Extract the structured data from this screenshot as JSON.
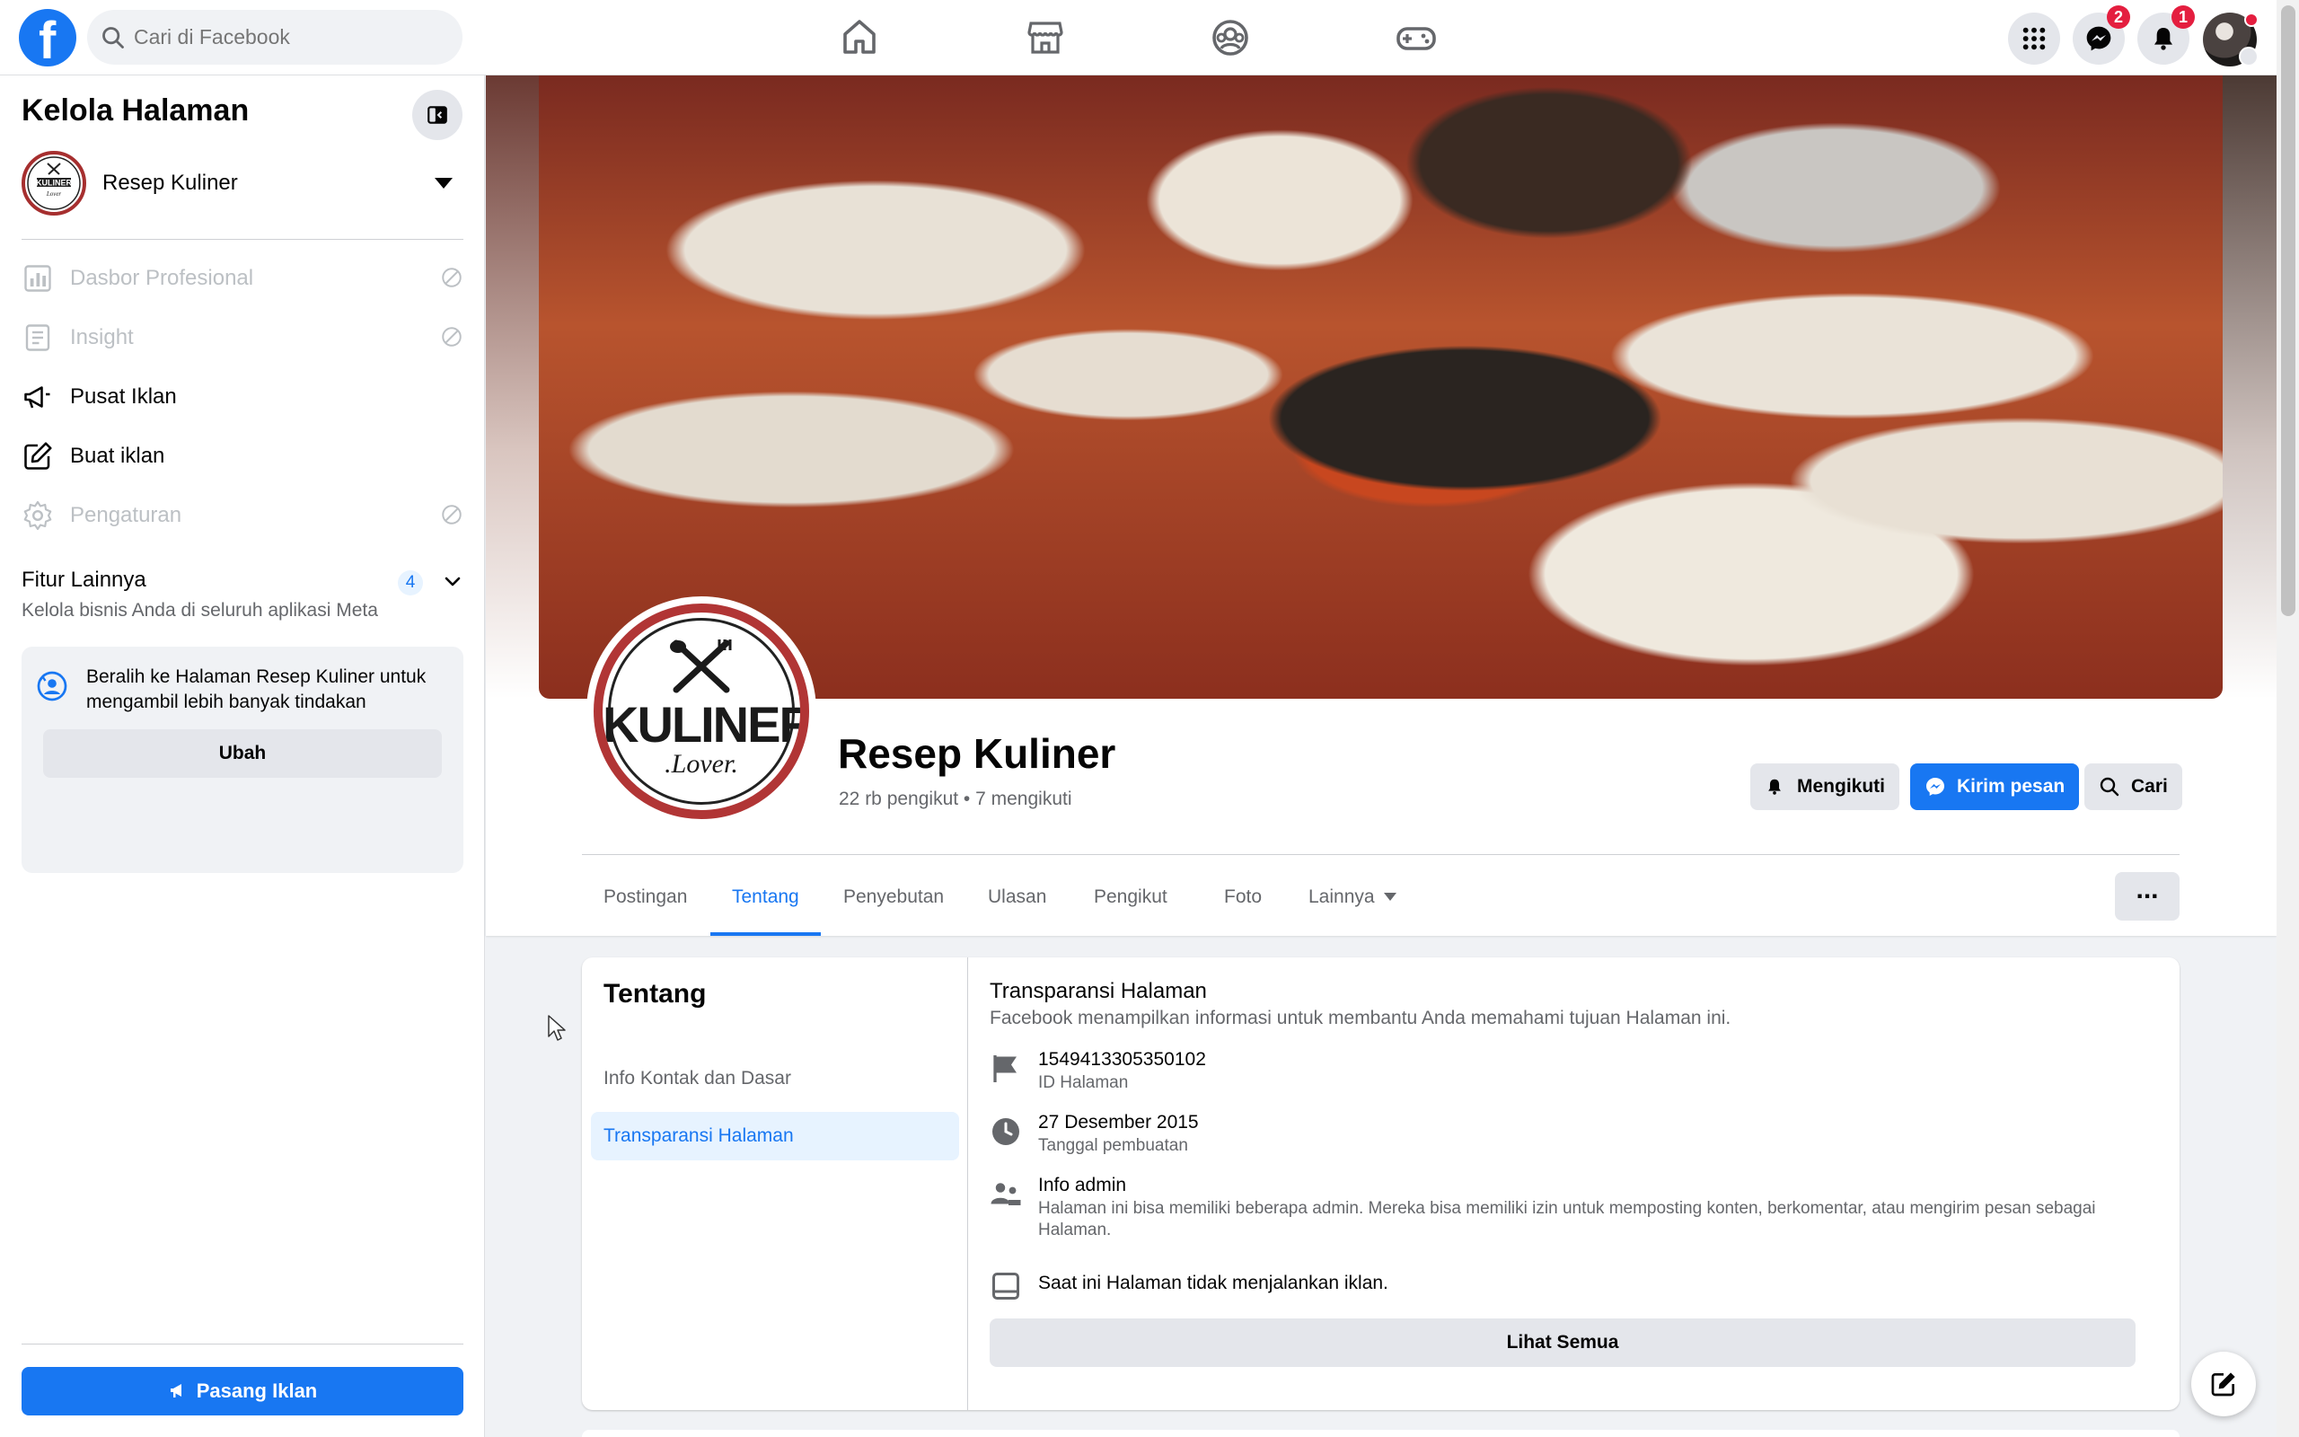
{
  "topbar": {
    "search_placeholder": "Cari di Facebook",
    "nav": [
      "home-icon",
      "marketplace-icon",
      "groups-icon",
      "gaming-icon"
    ],
    "messenger_badge": "2",
    "notifications_badge": "1"
  },
  "sidebar": {
    "title": "Kelola Halaman",
    "page_name": "Resep Kuliner",
    "items": [
      {
        "label": "Dasbor Profesional",
        "icon": "dashboard-icon",
        "disabled": true
      },
      {
        "label": "Insight",
        "icon": "insight-icon",
        "disabled": true
      },
      {
        "label": "Pusat Iklan",
        "icon": "megaphone-icon",
        "disabled": false
      },
      {
        "label": "Buat iklan",
        "icon": "edit-icon",
        "disabled": false
      },
      {
        "label": "Pengaturan",
        "icon": "gear-icon",
        "disabled": true
      }
    ],
    "more_title": "Fitur Lainnya",
    "more_count": "4",
    "more_sub": "Kelola bisnis Anda di seluruh aplikasi Meta",
    "switch_text": "Beralih ke Halaman Resep Kuliner untuk mengambil lebih banyak tindakan",
    "switch_button": "Ubah",
    "promote_button": "Pasang Iklan"
  },
  "page": {
    "name": "Resep Kuliner",
    "stats": "22 rb pengikut • 7 mengikuti",
    "logo_text_top": "KULINER",
    "logo_text_bottom": ".Lover.",
    "buttons": {
      "following": "Mengikuti",
      "message": "Kirim pesan",
      "search": "Cari"
    },
    "tabs": [
      "Postingan",
      "Tentang",
      "Penyebutan",
      "Ulasan",
      "Pengikut",
      "Foto",
      "Lainnya"
    ],
    "active_tab": "Tentang",
    "more_button": "..."
  },
  "about": {
    "title": "Tentang",
    "links": [
      "Info Kontak dan Dasar",
      "Transparansi Halaman"
    ],
    "active_link": "Transparansi Halaman",
    "section_title": "Transparansi Halaman",
    "section_sub": "Facebook menampilkan informasi untuk membantu Anda memahami tujuan Halaman ini.",
    "page_id": "1549413305350102",
    "page_id_label": "ID Halaman",
    "created_date": "27 Desember 2015",
    "created_label": "Tanggal pembuatan",
    "admin_title": "Info admin",
    "admin_desc": "Halaman ini bisa memiliki beberapa admin. Mereka bisa memiliki izin untuk memposting konten, berkomentar, atau mengirim pesan sebagai Halaman.",
    "ads_status": "Saat ini Halaman tidak menjalankan iklan.",
    "see_all": "Lihat Semua"
  },
  "colors": {
    "brand": "#1877f2",
    "badge": "#e41e3f",
    "logo_ring": "#b13535"
  }
}
